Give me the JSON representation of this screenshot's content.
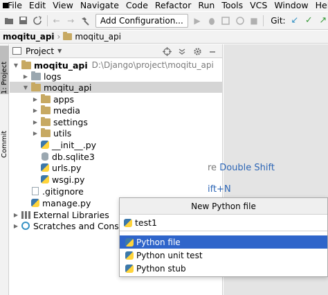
{
  "menubar": {
    "items": [
      {
        "label": "File"
      },
      {
        "label": "Edit"
      },
      {
        "label": "View"
      },
      {
        "label": "Navigate"
      },
      {
        "label": "Code"
      },
      {
        "label": "Refactor"
      },
      {
        "label": "Run"
      },
      {
        "label": "Tools"
      },
      {
        "label": "VCS"
      },
      {
        "label": "Window"
      },
      {
        "label": "Help"
      }
    ]
  },
  "toolbar": {
    "config_label": "Add Configuration...",
    "git_label": "Git:"
  },
  "breadcrumb": {
    "root": "moqitu_api",
    "child": "moqitu_api"
  },
  "strip": {
    "project_tab": "1: Project",
    "commit_tab": "Commit"
  },
  "panel": {
    "title": "Project"
  },
  "tree": {
    "root_name": "moqitu_api",
    "root_path": "D:\\Django\\project\\moqitu_api",
    "items": [
      {
        "label": "logs"
      },
      {
        "label": "moqitu_api"
      },
      {
        "label": "apps"
      },
      {
        "label": "media"
      },
      {
        "label": "settings"
      },
      {
        "label": "utils"
      },
      {
        "label": "__init__.py"
      },
      {
        "label": "db.sqlite3"
      },
      {
        "label": "urls.py"
      },
      {
        "label": "wsgi.py"
      },
      {
        "label": ".gitignore"
      },
      {
        "label": "manage.py"
      },
      {
        "label": "External Libraries"
      },
      {
        "label": "Scratches and Consoles"
      }
    ]
  },
  "editor": {
    "hint_prefix": "re ",
    "hint_key": "Double Shift",
    "hint2": "ift+N"
  },
  "dialog": {
    "title": "New Python file",
    "input_value": "test1",
    "options": [
      {
        "label": "Python file"
      },
      {
        "label": "Python unit test"
      },
      {
        "label": "Python stub"
      }
    ]
  },
  "colors": {
    "selection": "#2f65ca",
    "folder": "#c7a962",
    "link": "#2c65b5"
  }
}
